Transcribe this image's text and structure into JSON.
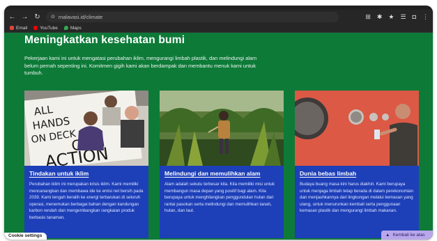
{
  "browser": {
    "url": "malavasi.id/climate",
    "bookmarks": [
      {
        "label": "Email",
        "color": "#e0443a"
      },
      {
        "label": "YouTube",
        "color": "#ff0000"
      },
      {
        "label": "Maps",
        "color": "#34a853"
      }
    ]
  },
  "page": {
    "heading": "Meningkatkan kesehatan bumi",
    "intro": "Pekerjaan kami ini untuk mengatasi perubahan iklim, mengurangi limbah plastik, dan melindungi alam belum pernah sepenting ini. Komitmen gigih kami akan berdampak dan membantu menuk kami untuk tumbuh."
  },
  "cards": [
    {
      "title": "Tindakan untuk iklim",
      "desc": "Perubahan iklim ini merupakan krisis iklim. Kami memiliki mencanangkan dan membawa ide ke emisi net bersih pada 2039. Kami tengah beralih ke energi terbarukan di seluruh operasi, menemukan berbagai bahan dengan kandungan karbon rendah dan mengembangkan rangkaian produk berbasis tanaman.",
      "sign": {
        "line1": "ALL",
        "line2": "HANDS",
        "line3": "ON DECK",
        "line4": "CLIM",
        "line5": "ACTION"
      }
    },
    {
      "title": "Melindungi dan memulihkan alam",
      "desc": "Alam adalah sekutu terbesar kita. Kita memiliki misi untuk membangun masa depan yang positif bagi alam. Kita berupaya untuk menghilangkan penggundulan hutan dari rantai pasokan serta melindungi dan memulihkan tanah, hutan, dan laut."
    },
    {
      "title": "Dunia bebas limbah",
      "desc": "Budaya buang masa kini harus diakhiri. Kami berupaya untuk menjaga limbah tetap berada di dalam perekonomian dan menjauhkannya dari lingkungan melalui kemasan yang ulang, untuk menurunkan kembali serta penggunaan kemasan plastik dan mengurangi limbah makanan."
    }
  ],
  "footer": {
    "cookie_label": "Cookie settings",
    "back_to_top_label": "Kembali ke atas"
  },
  "colors": {
    "page_bg": "#0d7a38",
    "card_bg": "#1d3fb8",
    "back_to_top_bg": "#b9a7ec"
  }
}
